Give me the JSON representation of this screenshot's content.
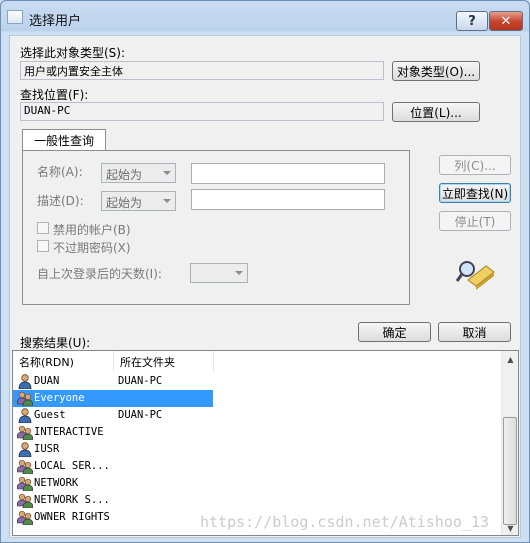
{
  "window": {
    "title": "选择用户",
    "help_label": "?",
    "close_label": "✕"
  },
  "object_type": {
    "label": "选择此对象类型(S):",
    "value": "用户或内置安全主体",
    "button": "对象类型(O)..."
  },
  "location": {
    "label": "查找位置(F):",
    "value": "DUAN-PC",
    "button": "位置(L)..."
  },
  "tab": {
    "label": "一般性查询"
  },
  "query": {
    "name_label": "名称(A):",
    "name_mode": "起始为",
    "name_value": "",
    "desc_label": "描述(D):",
    "desc_mode": "起始为",
    "desc_value": "",
    "disabled_accounts": "禁用的帐户(B)",
    "non_expiring_pw": "不过期密码(X)",
    "days_label": "自上次登录后的天数(I):",
    "days_value": ""
  },
  "side_buttons": {
    "columns": "列(C)...",
    "find_now": "立即查找(N)",
    "stop": "停止(T)"
  },
  "dialog_buttons": {
    "ok": "确定",
    "cancel": "取消"
  },
  "results": {
    "label": "搜索结果(U):",
    "headers": [
      "名称(RDN)",
      "所在文件夹"
    ],
    "rows": [
      {
        "name": "DUAN",
        "folder": "DUAN-PC",
        "icon": "user-icon"
      },
      {
        "name": "Everyone",
        "folder": "",
        "icon": "group-icon"
      },
      {
        "name": "Guest",
        "folder": "DUAN-PC",
        "icon": "user-icon"
      },
      {
        "name": "INTERACTIVE",
        "folder": "",
        "icon": "group-icon"
      },
      {
        "name": "IUSR",
        "folder": "",
        "icon": "user-icon"
      },
      {
        "name": "LOCAL SER...",
        "folder": "",
        "icon": "group-icon"
      },
      {
        "name": "NETWORK",
        "folder": "",
        "icon": "group-icon"
      },
      {
        "name": "NETWORK S...",
        "folder": "",
        "icon": "group-icon"
      },
      {
        "name": "OWNER RIGHTS",
        "folder": "",
        "icon": "group-icon"
      }
    ],
    "selected_name": "Everyone"
  },
  "watermark": "https://blog.csdn.net/Atishoo_13"
}
